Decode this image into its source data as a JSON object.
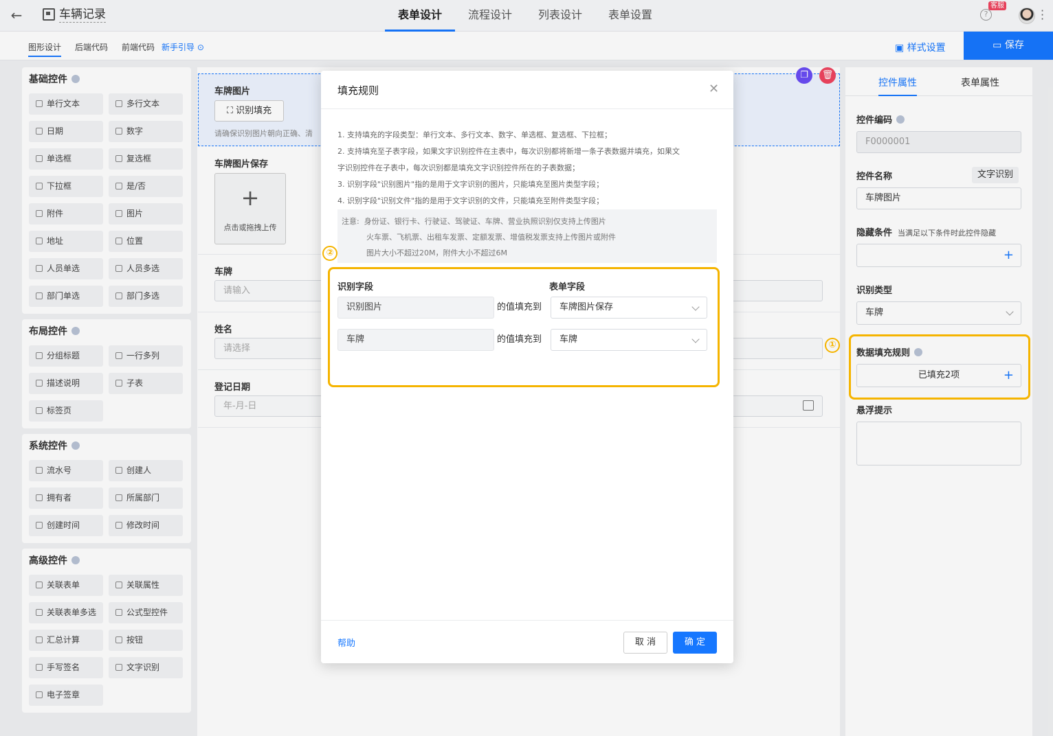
{
  "header": {
    "title": "车辆记录",
    "tabs": [
      "表单设计",
      "流程设计",
      "列表设计",
      "表单设置"
    ],
    "kefu_badge": "客服"
  },
  "subbar": {
    "tabs": [
      "图形设计",
      "后端代码",
      "前端代码"
    ],
    "guide": "新手引导",
    "style_settings": "样式设置",
    "save": "保存"
  },
  "left_panel": {
    "groups": [
      {
        "title": "基础控件",
        "items": [
          "单行文本",
          "多行文本",
          "日期",
          "数字",
          "单选框",
          "复选框",
          "下拉框",
          "是/否",
          "附件",
          "图片",
          "地址",
          "位置",
          "人员单选",
          "人员多选",
          "部门单选",
          "部门多选"
        ]
      },
      {
        "title": "布局控件",
        "items": [
          "分组标题",
          "一行多列",
          "描述说明",
          "子表",
          "标签页"
        ]
      },
      {
        "title": "系统控件",
        "items": [
          "流水号",
          "创建人",
          "拥有者",
          "所属部门",
          "创建时间",
          "修改时间"
        ]
      },
      {
        "title": "高级控件",
        "items": [
          "关联表单",
          "关联属性",
          "关联表单多选",
          "公式型控件",
          "汇总计算",
          "按钮",
          "手写签名",
          "文字识别",
          "电子签章"
        ]
      }
    ]
  },
  "canvas": {
    "field1_label": "车牌图片",
    "ocr_button": "识别填充",
    "ocr_tip": "请确保识别图片朝向正确、清",
    "field2_label": "车牌图片保存",
    "upload_text": "点击或拖拽上传",
    "field3_label": "车牌",
    "field3_placeholder": "请输入",
    "field4_label": "姓名",
    "field4_placeholder": "请选择",
    "field5_label": "登记日期",
    "field5_placeholder": "年-月-日"
  },
  "right_panel": {
    "tabs": [
      "控件属性",
      "表单属性"
    ],
    "code_label": "控件编码",
    "code_value": "F0000001",
    "name_label": "控件名称",
    "name_tag": "文字识别",
    "name_value": "车牌图片",
    "hide_label": "隐藏条件",
    "hide_sub": "当满足以下条件时此控件隐藏",
    "type_label": "识别类型",
    "type_value": "车牌",
    "fill_label": "数据填充规则",
    "fill_value": "已填充2项",
    "hover_label": "悬浮提示"
  },
  "modal": {
    "title": "填充规则",
    "rules": [
      "1. 支持填充的字段类型：单行文本、多行文本、数字、单选框、复选框、下拉框；",
      "2. 支持填充至子表字段，如果文字识别控件在主表中，每次识别都将新增一条子表数据并填充，如果文",
      "字识别控件在子表中，每次识别都是填充文字识别控件所在的子表数据；",
      "3. 识别字段\"识别图片\"指的是用于文字识别的图片，只能填充至图片类型字段；",
      "4. 识别字段\"识别文件\"指的是用于文字识别的文件，只能填充至附件类型字段；"
    ],
    "note_prefix": "注意:",
    "note_lines": [
      "身份证、银行卡、行驶证、驾驶证、车牌、营业执照识别仅支持上传图片",
      "火车票、飞机票、出租车发票、定额发票、增值税发票支持上传图片或附件",
      "图片大小不超过20M，附件大小不超过6M"
    ],
    "col_src": "识别字段",
    "col_dst": "表单字段",
    "mid_text": "的值填充到",
    "rows": [
      {
        "src": "识别图片",
        "dst": "车牌图片保存"
      },
      {
        "src": "车牌",
        "dst": "车牌"
      }
    ],
    "help": "帮助",
    "cancel": "取 消",
    "ok": "确 定"
  },
  "annotations": {
    "mark1": "①",
    "mark2": "②"
  },
  "colors": {
    "accent": "#1677ff",
    "highlight": "#f5b400",
    "danger": "#f0445f"
  }
}
